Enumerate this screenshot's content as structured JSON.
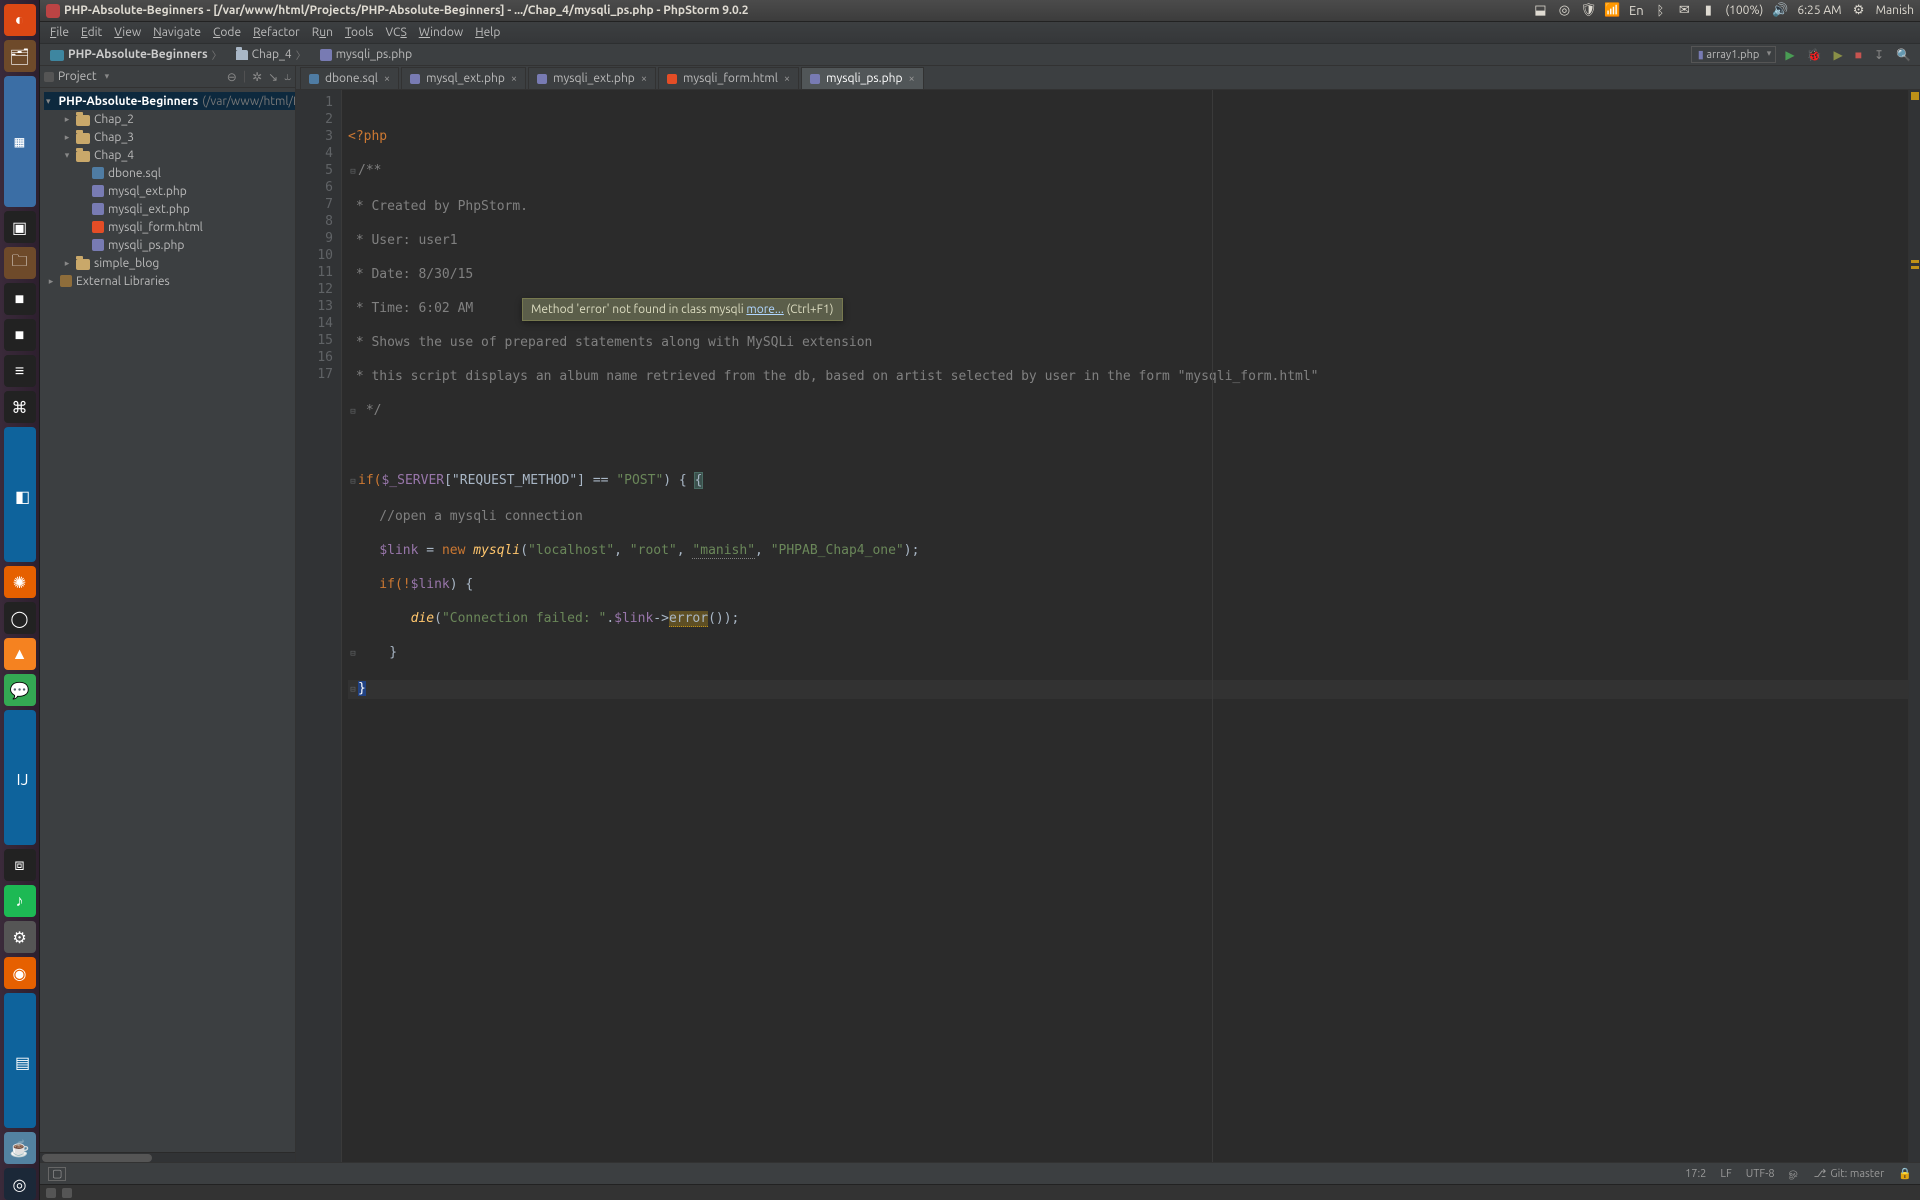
{
  "os": {
    "window_title": "PHP-Absolute-Beginners - [/var/www/html/Projects/PHP-Absolute-Beginners] - .../Chap_4/mysqli_ps.php - PhpStorm 9.0.2",
    "tray": {
      "battery": "(100%)",
      "time": "6:25 AM",
      "user": "Manish",
      "volume_icon": "volume-icon",
      "network_icon": "wifi-icon",
      "keyboard": "En",
      "bt_icon": "bluetooth-icon",
      "mail_icon": "mail-icon",
      "dropbox_icon": "dropbox-icon",
      "chrome_icon": "chrome-icon",
      "shield_icon": "shield-icon"
    }
  },
  "menubar": [
    "File",
    "Edit",
    "View",
    "Navigate",
    "Code",
    "Refactor",
    "Run",
    "Tools",
    "VCS",
    "Window",
    "Help"
  ],
  "breadcrumb": {
    "root": "PHP-Absolute-Beginners",
    "folder": "Chap_4",
    "file": "mysqli_ps.php"
  },
  "nav_right": {
    "run_config": "array1.php"
  },
  "project_pane": {
    "title": "Project",
    "root": {
      "name": "PHP-Absolute-Beginners",
      "path": "(/var/www/html/P"
    },
    "tree": [
      {
        "type": "folder",
        "name": "Chap_2",
        "depth": 1,
        "expanded": false
      },
      {
        "type": "folder",
        "name": "Chap_3",
        "depth": 1,
        "expanded": false
      },
      {
        "type": "folder",
        "name": "Chap_4",
        "depth": 1,
        "expanded": true,
        "children": [
          {
            "type": "sql",
            "name": "dbone.sql"
          },
          {
            "type": "php",
            "name": "mysql_ext.php"
          },
          {
            "type": "php",
            "name": "mysqli_ext.php"
          },
          {
            "type": "html",
            "name": "mysqli_form.html"
          },
          {
            "type": "php",
            "name": "mysqli_ps.php"
          }
        ]
      },
      {
        "type": "folder",
        "name": "simple_blog",
        "depth": 1,
        "expanded": false
      },
      {
        "type": "lib",
        "name": "External Libraries",
        "depth": 0
      }
    ]
  },
  "editor_tabs": [
    {
      "name": "dbone.sql",
      "kind": "sql",
      "active": false
    },
    {
      "name": "mysql_ext.php",
      "kind": "php",
      "active": false
    },
    {
      "name": "mysqli_ext.php",
      "kind": "php",
      "active": false
    },
    {
      "name": "mysqli_form.html",
      "kind": "html",
      "active": false
    },
    {
      "name": "mysqli_ps.php",
      "kind": "php",
      "active": true
    }
  ],
  "code": {
    "lines": 17,
    "l1": "<?php",
    "l2": "/**",
    "l3": " * Created by PhpStorm.",
    "l4": " * User: user1",
    "l5": " * Date: 8/30/15",
    "l6": " * Time: 6:02 AM",
    "l7": " * Shows the use of prepared statements along with MySQLi extension",
    "l8": " * this script displays an album name retrieved from the db, based on artist selected by user in the form \"mysqli_form.html\"",
    "l9": " */",
    "l11_pre": "if(",
    "l11_var": "$_SERVER",
    "l11_idx": "[\"REQUEST_METHOD\"]",
    "l11_eq": " == ",
    "l11_post_str": "\"POST\"",
    "l11_tail": ") {",
    "l12": "    //open a mysqli connection",
    "l13_pre": "    ",
    "l13_var": "$link",
    "l13_eq": " = ",
    "l13_new": "new ",
    "l13_cls": "mysqli",
    "l13_args_open": "(",
    "l13_a1": "\"localhost\"",
    "l13_c": ", ",
    "l13_a2": "\"root\"",
    "l13_a3": "\"manish\"",
    "l13_a4": "\"PHPAB_Chap4_one\"",
    "l13_close": ");",
    "l14_pre": "    if(!",
    "l14_var": "$link",
    "l14_tail": ") {",
    "l15_pre": "        ",
    "l15_fn": "die",
    "l15_open": "(",
    "l15_str": "\"Connection failed: \"",
    "l15_dot": ".",
    "l15_var": "$link",
    "l15_arrow": "->",
    "l15_err": "error",
    "l15_tail": "());",
    "l16": "    }",
    "l17": "}"
  },
  "inspection": {
    "msg": "Method 'error' not found in class mysqli ",
    "more": "more...",
    "hint": " (Ctrl+F1)"
  },
  "status": {
    "pos": "17:2",
    "eol": "LF",
    "enc": "UTF-8",
    "ctx": "ௐ",
    "git_branch": "Git: master",
    "lock": "🔒"
  }
}
